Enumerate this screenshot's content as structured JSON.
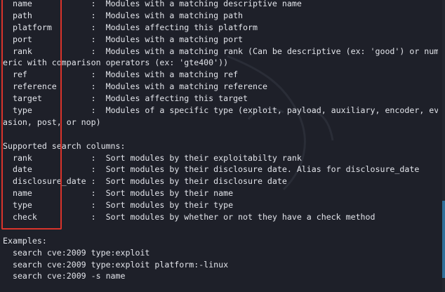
{
  "filters": [
    {
      "key": "  name           ",
      "desc": "Modules with a matching descriptive name"
    },
    {
      "key": "  path           ",
      "desc": "Modules with a matching path"
    },
    {
      "key": "  platform       ",
      "desc": "Modules affecting this platform"
    },
    {
      "key": "  port           ",
      "desc": "Modules with a matching port"
    },
    {
      "key": "  rank           ",
      "desc": "Modules with a matching rank (Can be descriptive (ex: 'good') or num"
    },
    {
      "key": "eric with comparison operators (ex: 'gte400'))",
      "desc": "",
      "wrap": true
    },
    {
      "key": "  ref            ",
      "desc": "Modules with a matching ref"
    },
    {
      "key": "  reference      ",
      "desc": "Modules with a matching reference"
    },
    {
      "key": "  target         ",
      "desc": "Modules affecting this target"
    },
    {
      "key": "  type           ",
      "desc": "Modules of a specific type (exploit, payload, auxiliary, encoder, ev"
    },
    {
      "key": "asion, post, or nop)",
      "desc": "",
      "wrap": true
    }
  ],
  "columns_heading": "Supported search columns:",
  "columns": [
    {
      "key": "  rank           ",
      "desc": "Sort modules by their exploitabilty rank"
    },
    {
      "key": "  date           ",
      "desc": "Sort modules by their disclosure date. Alias for disclosure_date"
    },
    {
      "key": "  disclosure_date",
      "desc": "Sort modules by their disclosure date"
    },
    {
      "key": "  name           ",
      "desc": "Sort modules by their name"
    },
    {
      "key": "  type           ",
      "desc": "Sort modules by their type"
    },
    {
      "key": "  check          ",
      "desc": "Sort modules by whether or not they have a check method"
    }
  ],
  "examples_heading": "Examples:",
  "examples": [
    "  search cve:2009 type:exploit",
    "  search cve:2009 type:exploit platform:-linux",
    "  search cve:2009 -s name"
  ],
  "colors": {
    "background": "#1e2029",
    "text": "#e2e4ea",
    "highlight": "#d9342b",
    "scrollbar": "#2f6f9a"
  }
}
